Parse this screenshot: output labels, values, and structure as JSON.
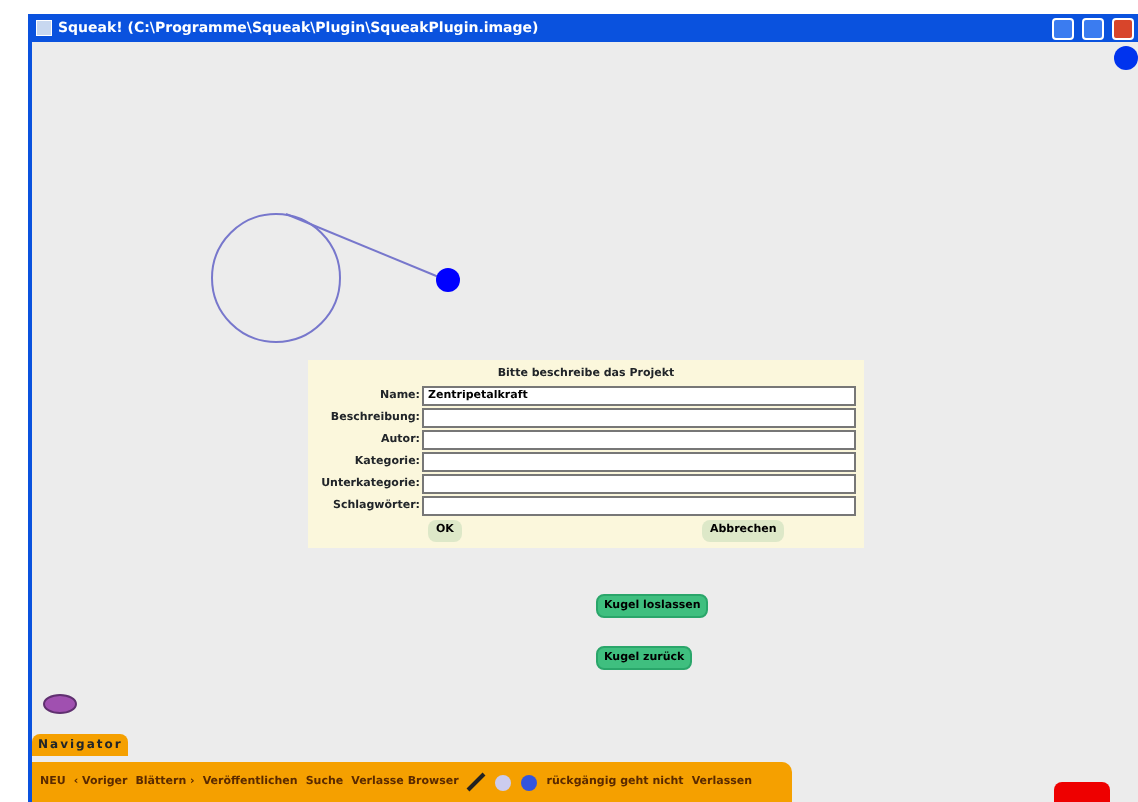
{
  "window": {
    "title": "Squeak! (C:\\Programme\\Squeak\\Plugin\\SqueakPlugin.image)"
  },
  "dialog": {
    "title": "Bitte beschreibe das Projekt",
    "fields": [
      {
        "label": "Name:",
        "value": "Zentripetalkraft"
      },
      {
        "label": "Beschreibung:"
      },
      {
        "label": "Autor:"
      },
      {
        "label": "Kategorie:"
      },
      {
        "label": "Unterkategorie:"
      },
      {
        "label": "Schlagwörter:"
      }
    ],
    "buttons": [
      "OK",
      "Abbrechen"
    ]
  },
  "world_buttons": [
    "Kugel loslassen",
    "Kugel zurück"
  ],
  "navigator": {
    "tab": "Navigator",
    "items": [
      {
        "kind": "text",
        "label": "NEU"
      },
      {
        "kind": "text",
        "label": "‹ Voriger"
      },
      {
        "kind": "text",
        "label": "Blättern ›"
      },
      {
        "kind": "text",
        "label": "Veröffentlichen"
      },
      {
        "kind": "text",
        "label": "Suche"
      },
      {
        "kind": "text",
        "label": "Verlasse Browser"
      },
      {
        "kind": "paint"
      },
      {
        "kind": "sound"
      },
      {
        "kind": "globe"
      },
      {
        "kind": "text",
        "label": "rückgängig geht nicht"
      },
      {
        "kind": "text",
        "label": "Verlassen"
      }
    ]
  }
}
